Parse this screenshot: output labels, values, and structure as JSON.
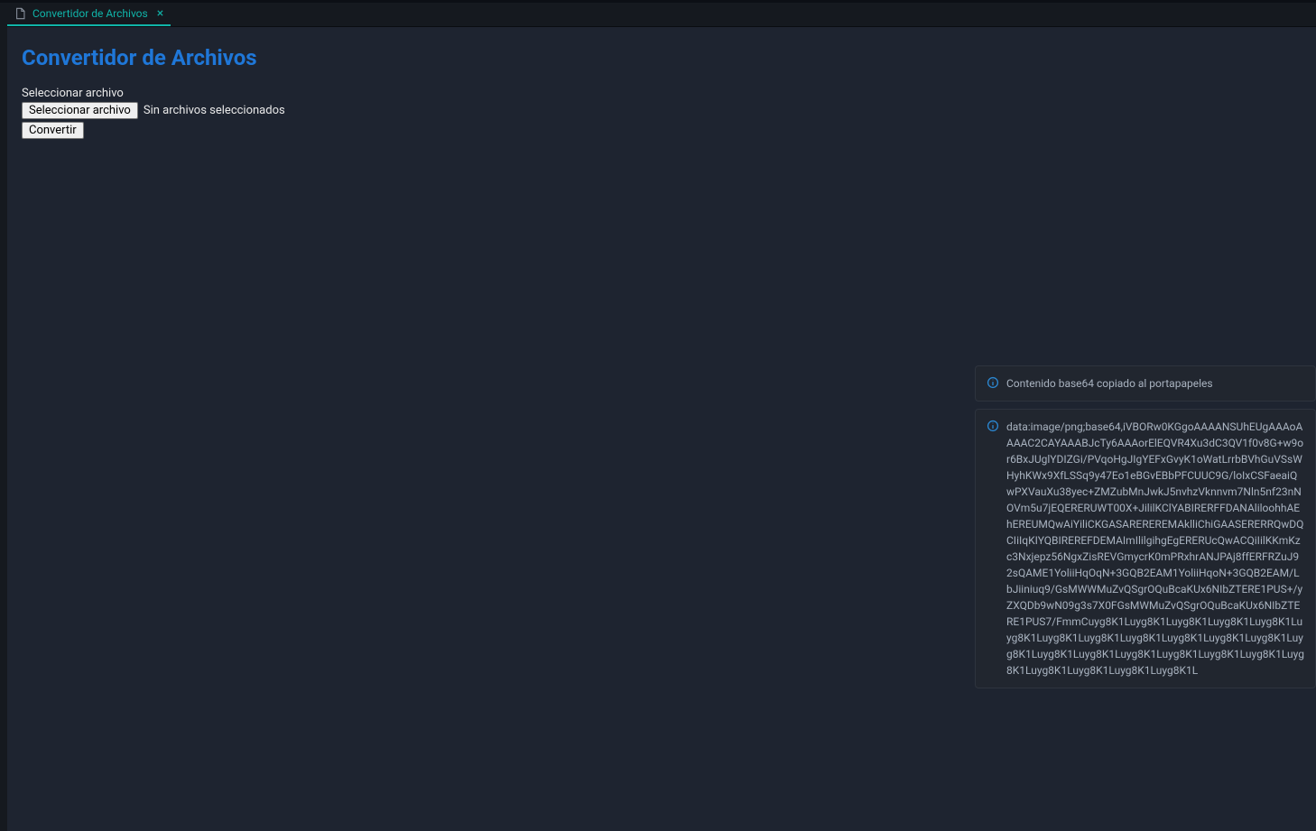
{
  "tab": {
    "title": "Convertidor de Archivos"
  },
  "page": {
    "title": "Convertidor de Archivos",
    "file_label": "Seleccionar archivo",
    "file_button": "Seleccionar archivo",
    "file_status": "Sin archivos seleccionados",
    "convert_button": "Convertir"
  },
  "notifications": {
    "copied": "Contenido base64 copiado al portapapeles",
    "base64": "data:image/png;base64,iVBORw0KGgoAAAANSUhEUgAAAoAAAAC2CAYAAABJcTy6AAAorElEQVR4Xu3dC3QV1f0v8G+w9or6BxJUglYDIZGi/PVqoHgJIgYEFxGvyK1oWatLrrbBVhGuVSsWHyhKWx9XfLSSq9y47Eo1eBGvEBbPFCUUC9G/loIxCSFaeaiQwPXVauXu38yec+ZMZubMnJwkJ5nvhzVknnvm7Nln5nf23nNOVm5u7jEQERERUWT00X+JililKClYABIRERFFDANAliloohhAEhEREUMQwAiYiliCKGASAREREREMAklliChiGAASERERRQwDQCIiIqKIYQBIREREFDEMAImIlilgihgEgERERUcQwACQiIilKKmKzc3Nxjepz56NgxZisREVGmycrK0mPRxhrANJPAj8ffERFRZuJ92sQAME1YoliiHqOqN+3GQB2EAM1YoliiHqoN+3GQB2EAM/LbJiiniuq9/GsMWWMuZvQSgrOQuBcaKUx6NIbZTERE1PUS+/yZXQDb9wN09g3s7X0FGsMWMuZvQSgrOQuBcaKUx6NIbZTERE1PUS7/FmmCuyg8K1Luyg8K1Luyg8K1Luyg8K1Luyg8K1Luyg8K1Luyg8K1Luyg8K1Luyg8K1Luyg8K1Luyg8K1Luyg8K1Luyg8K1Luyg8K1Luyg8K1Luyg8K1Luyg8K1Luyg8K1Luyg8K1Luyg8K1Luyg8K1Luyg8K1Luyg8K1Luyg8K1L"
  }
}
